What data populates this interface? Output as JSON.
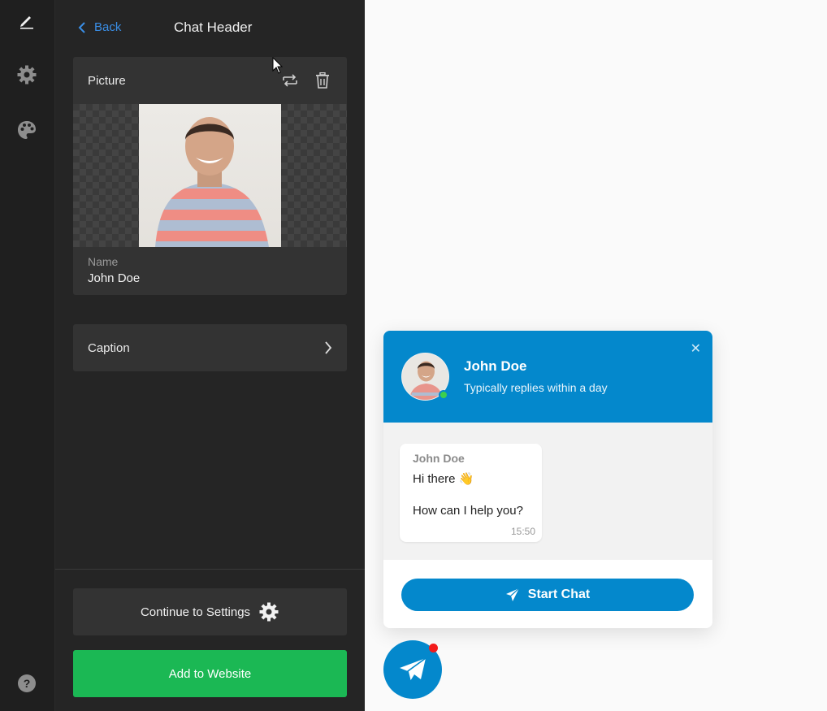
{
  "rail": {
    "items": [
      {
        "icon": "pencil-icon"
      },
      {
        "icon": "gear-icon"
      },
      {
        "icon": "palette-icon"
      }
    ],
    "help_icon": "help-icon"
  },
  "editor": {
    "back_label": "Back",
    "title": "Chat Header",
    "picture_label": "Picture",
    "name_label": "Name",
    "name_value": "John Doe",
    "caption_label": "Caption",
    "continue_label": "Continue to Settings",
    "add_label": "Add to Website"
  },
  "widget": {
    "name": "John Doe",
    "status": "Typically replies within a day",
    "close_icon": "✕",
    "message": {
      "sender": "John Doe",
      "line1": "Hi there 👋",
      "line2": "How can I help you?",
      "time": "15:50"
    },
    "start_label": "Start Chat"
  },
  "colors": {
    "accent": "#0488cc",
    "add_button": "#1bb854",
    "panel": "#252525",
    "notification": "#f31b1b"
  }
}
